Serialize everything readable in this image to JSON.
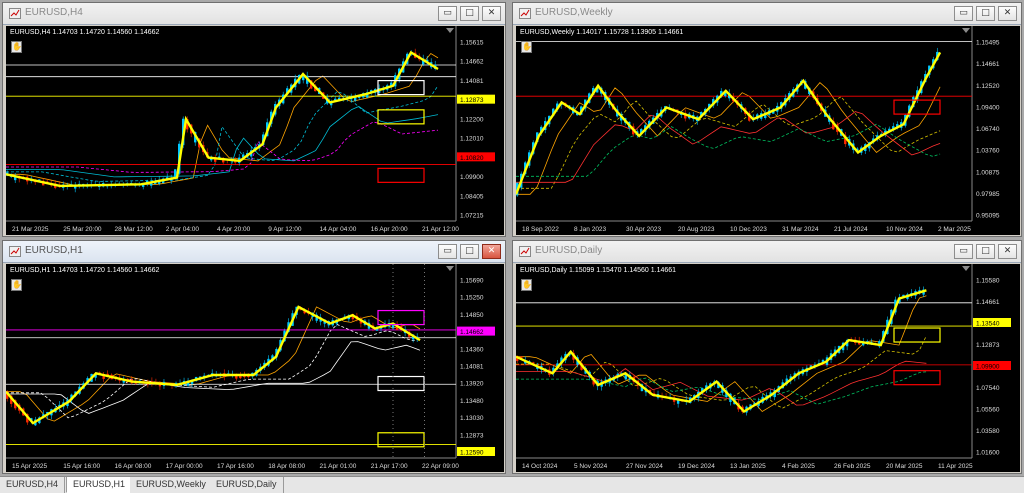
{
  "windows": [
    {
      "id": "h4",
      "title": "EURUSD,H4",
      "info": "EURUSD,H4  1.14703 1.14720 1.14560 1.14662",
      "price_labels": [
        "1.15615",
        "1.14662",
        "1.14081",
        "1.12873",
        "1.12200",
        "1.12010",
        "1.10820",
        "1.09900",
        "1.08405",
        "1.07215"
      ],
      "time_labels": [
        "21 Mar 2025",
        "25 Mar 20:00",
        "28 Mar 12:00",
        "2 Apr 04:00",
        "4 Apr 20:00",
        "9 Apr 12:00",
        "14 Apr 04:00",
        "16 Apr 20:00",
        "21 Apr 12:00"
      ]
    },
    {
      "id": "weekly",
      "title": "EURUSD,Weekly",
      "info": "EURUSD,Weekly  1.14017 1.15728 1.13905 1.14661",
      "price_labels": [
        "1.15495",
        "1.14661",
        "1.12520",
        "1.09400",
        "1.06740",
        "1.03760",
        "1.00875",
        "0.97985",
        "0.95095"
      ],
      "time_labels": [
        "18 Sep 2022",
        "8 Jan 2023",
        "30 Apr 2023",
        "20 Aug 2023",
        "10 Dec 2023",
        "31 Mar 2024",
        "21 Jul 2024",
        "10 Nov 2024",
        "2 Mar 2025"
      ]
    },
    {
      "id": "h1",
      "title": "EURUSD,H1",
      "info": "EURUSD,H1  1.14703 1.14720 1.14560 1.14662",
      "price_labels": [
        "1.15690",
        "1.15250",
        "1.14850",
        "1.14662",
        "1.14360",
        "1.14081",
        "1.13920",
        "1.13480",
        "1.13030",
        "1.12873",
        "1.12590"
      ],
      "time_labels": [
        "15 Apr 2025",
        "15 Apr 16:00",
        "16 Apr 08:00",
        "17 Apr 00:00",
        "17 Apr 16:00",
        "18 Apr 08:00",
        "21 Apr 01:00",
        "21 Apr 17:00",
        "22 Apr 09:00"
      ]
    },
    {
      "id": "daily",
      "title": "EURUSD,Daily",
      "info": "EURUSD,Daily  1.15099 1.15470 1.14560 1.14661",
      "price_labels": [
        "1.15580",
        "1.14661",
        "1.13540",
        "1.12873",
        "1.09900",
        "1.07540",
        "1.05560",
        "1.03580",
        "1.01600"
      ],
      "time_labels": [
        "14 Oct 2024",
        "5 Nov 2024",
        "27 Nov 2024",
        "19 Dec 2024",
        "13 Jan 2025",
        "4 Feb 2025",
        "26 Feb 2025",
        "20 Mar 2025",
        "11 Apr 2025"
      ]
    }
  ],
  "window_buttons": {
    "minimize": "▭",
    "maximize": "□",
    "close": "✕"
  },
  "tabs": [
    "EURUSD,H4",
    "EURUSD,H1",
    "EURUSD,Weekly",
    "EURUSD,Daily"
  ],
  "active_tab": "EURUSD,H1",
  "colors": {
    "bull": "#00c8ff",
    "bear": "#ff2a00",
    "zigzag": "#ffff00",
    "level_yellow": "#ffff00",
    "level_red": "#ff0000",
    "level_magenta": "#ff00ff",
    "level_white": "#ffffff"
  }
}
